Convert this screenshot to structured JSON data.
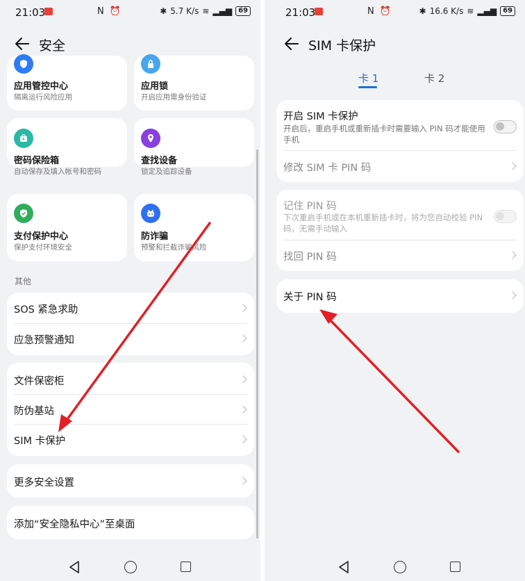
{
  "left": {
    "status": {
      "time": "21:03",
      "icons_mid": "N ⏰",
      "speed": "5.7 K/s",
      "battery": "69"
    },
    "header": {
      "title": "安全"
    },
    "tiles": [
      {
        "title": "应用管控中心",
        "subtitle": "隔离运行风险应用",
        "icon": "shield-icon",
        "color": "#2f7bf6"
      },
      {
        "title": "应用锁",
        "subtitle": "开启应用需身份验证",
        "icon": "lock-icon",
        "color": "#49a6ee"
      },
      {
        "title": "密码保险箱",
        "subtitle": "自动保存及填入帐号和密码",
        "icon": "safe-box-icon",
        "color": "#2bb9a4"
      },
      {
        "title": "查找设备",
        "subtitle": "锁定及追踪设备",
        "icon": "location-pin-icon",
        "color": "#8a3fe0"
      },
      {
        "title": "支付保护中心",
        "subtitle": "保护支付环境安全",
        "icon": "shield-check-icon",
        "color": "#2fae5c"
      },
      {
        "title": "防诈骗",
        "subtitle": "预警和拦截诈骗风险",
        "icon": "anti-fraud-icon",
        "color": "#2f6ff0"
      }
    ],
    "section_other": "其他",
    "group1": [
      "SOS 紧急求助",
      "应急预警通知"
    ],
    "group2": [
      "文件保密柜",
      "防伪基站",
      "SIM 卡保护"
    ],
    "more_settings": "更多安全设置",
    "add_desktop": "添加“安全隐私中心”至桌面"
  },
  "right": {
    "status": {
      "time": "21:03",
      "icons_mid": "N ⏰",
      "speed": "16.6 K/s",
      "battery": "69"
    },
    "header": {
      "title": "SIM 卡保护"
    },
    "tabs": [
      "卡 1",
      "卡 2"
    ],
    "enable": {
      "title": "开启 SIM 卡保护",
      "desc": "开启后，重启手机或重新插卡时需要输入 PIN 码才能使用手机",
      "toggle": "off"
    },
    "change_pin": "修改 SIM 卡 PIN 码",
    "remember": {
      "title": "记住 PIN 码",
      "desc": "下次重启手机或在本机重新插卡时，将为您自动校验 PIN 码，无需手动输入",
      "toggle": "off-disabled"
    },
    "recover_pin": "找回 PIN 码",
    "about_pin": "关于 PIN 码"
  },
  "colors": {
    "accent": "#1f6ed4",
    "arrow": "#e21f26",
    "background": "#f1f2f4"
  }
}
